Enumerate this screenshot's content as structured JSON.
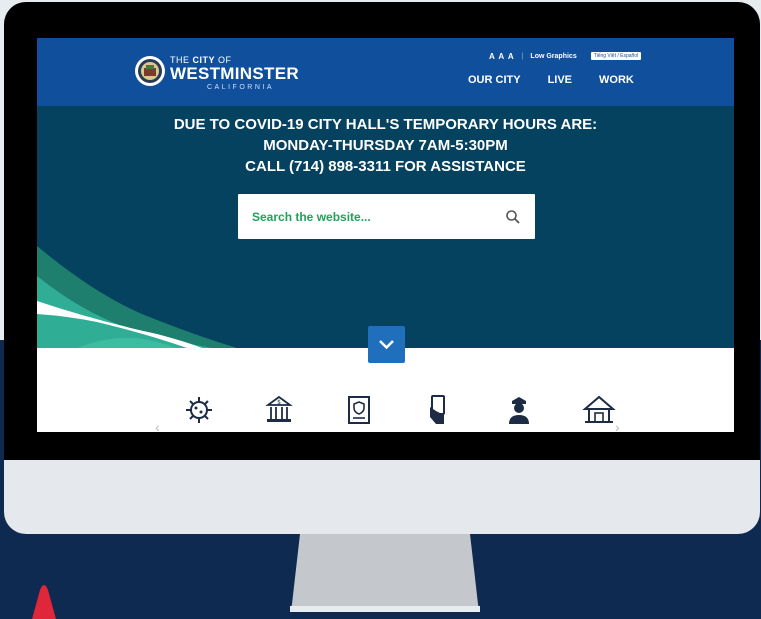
{
  "site": {
    "logo_the": "THE",
    "logo_city": "CITY",
    "logo_of": "OF",
    "logo_name": "WESTMINSTER",
    "logo_state": "CALIFORNIA"
  },
  "utility": {
    "text_sizes": "A A A",
    "low_graphics": "Low Graphics",
    "language": "Tiếng Việt / Español"
  },
  "nav": {
    "items": [
      "OUR CITY",
      "LIVE",
      "WORK"
    ]
  },
  "hero": {
    "line1": "DUE TO COVID-19 CITY HALL'S TEMPORARY HOURS ARE:",
    "line2": "MONDAY-THURSDAY 7AM-5:30PM",
    "line3": "CALL (714) 898-3311 FOR ASSISTANCE"
  },
  "search": {
    "placeholder": "Search the website..."
  },
  "colors": {
    "header_blue": "#0f4f9c",
    "hero_teal": "#05425f",
    "accent_green": "#1fa35a",
    "page_navy": "#0e2a51",
    "accent_red": "#e0263a"
  },
  "service_icons": [
    "virus-icon",
    "city-finance-icon",
    "document-badge-icon",
    "hand-card-icon",
    "police-officer-icon",
    "house-icon"
  ]
}
